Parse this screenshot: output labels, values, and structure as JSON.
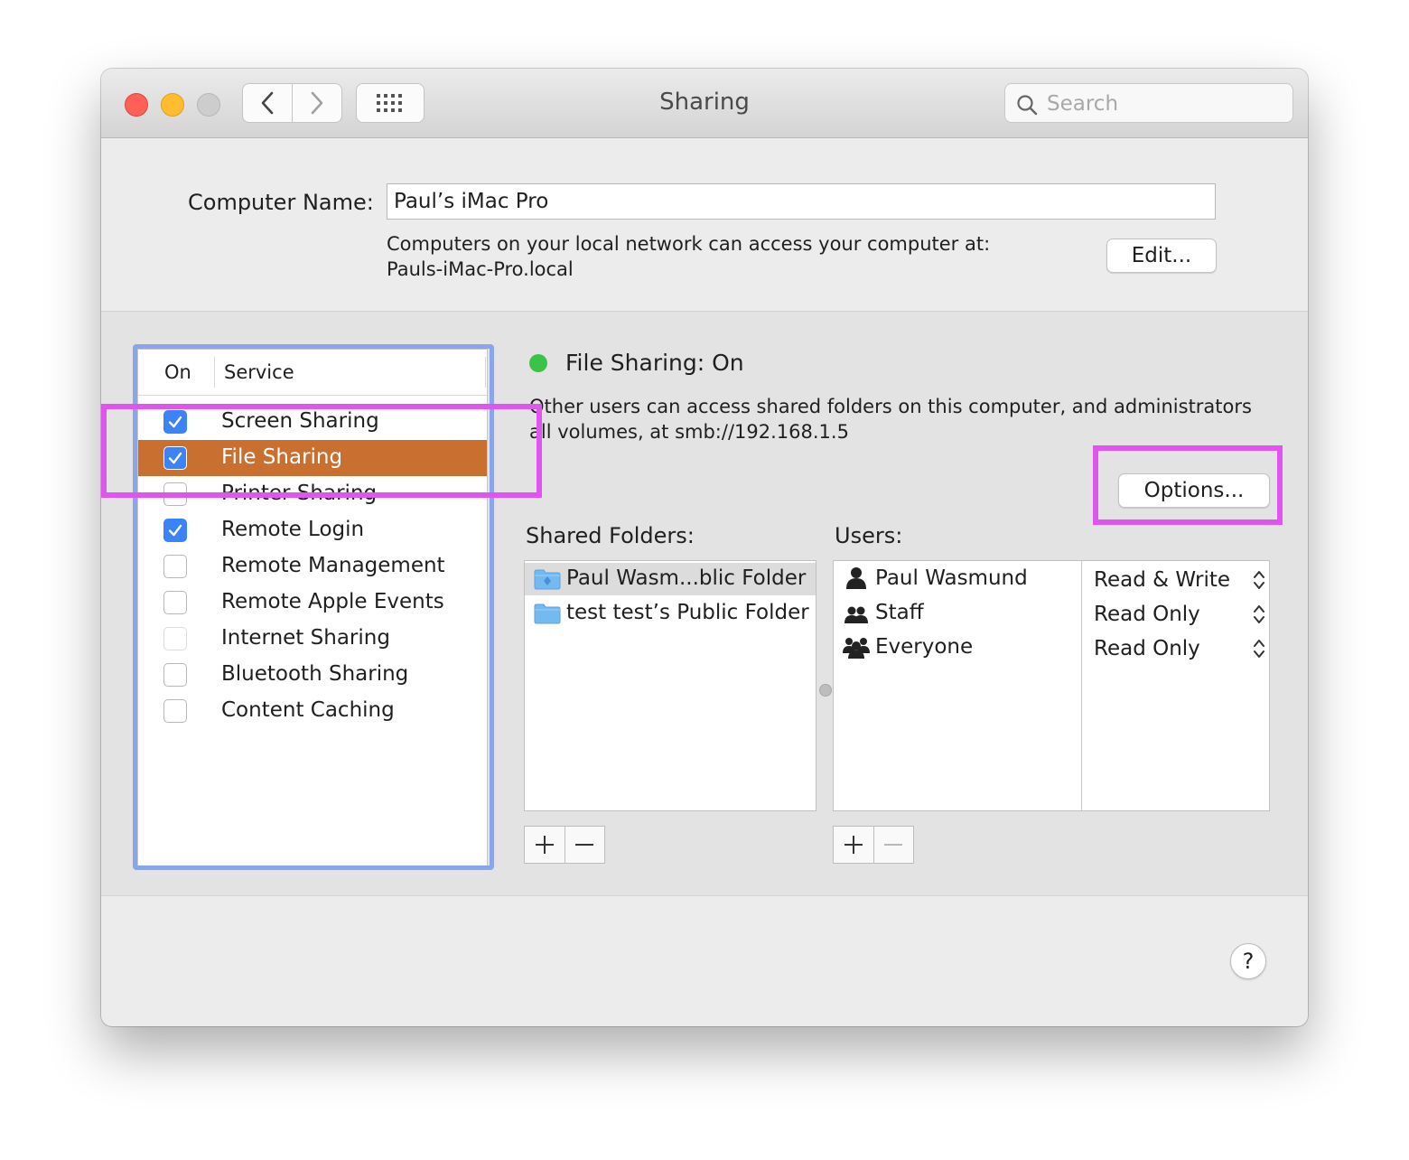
{
  "window": {
    "title": "Sharing",
    "search_placeholder": "Search"
  },
  "computer_name": {
    "label": "Computer Name:",
    "value": "Paul’s iMac Pro",
    "info_line1": "Computers on your local network can access your computer at:",
    "info_line2": "Pauls-iMac-Pro.local",
    "edit_label": "Edit..."
  },
  "services": {
    "header_on": "On",
    "header_service": "Service",
    "items": [
      {
        "label": "Screen Sharing",
        "checked": true
      },
      {
        "label": "File Sharing",
        "checked": true,
        "selected": true
      },
      {
        "label": "Printer Sharing",
        "checked": false
      },
      {
        "label": "Remote Login",
        "checked": true
      },
      {
        "label": "Remote Management",
        "checked": false
      },
      {
        "label": "Remote Apple Events",
        "checked": false
      },
      {
        "label": "Internet Sharing",
        "checked": false,
        "disabled": true
      },
      {
        "label": "Bluetooth Sharing",
        "checked": false
      },
      {
        "label": "Content Caching",
        "checked": false
      }
    ]
  },
  "detail": {
    "status": "File Sharing: On",
    "status_color": "#3cc24a",
    "desc_line1": "Other users can access shared folders on this computer, and administrators",
    "desc_line2": "all volumes, at smb://192.168.1.5",
    "options_label": "Options...",
    "shared_folders_label": "Shared Folders:",
    "users_label": "Users:",
    "folders": [
      {
        "name": "Paul Wasm...blic Folder",
        "icon": "public-folder-icon"
      },
      {
        "name": "test test’s Public Folder",
        "icon": "folder-icon"
      }
    ],
    "users": [
      {
        "name": "Paul Wasmund",
        "permission": "Read & Write",
        "icon": "user-icon"
      },
      {
        "name": "Staff",
        "permission": "Read Only",
        "icon": "group-icon"
      },
      {
        "name": "Everyone",
        "permission": "Read Only",
        "icon": "everyone-icon"
      }
    ]
  },
  "colors": {
    "selection": "#c96f2f",
    "checkbox_on": "#3b83f6",
    "highlight_pink": "#e055f0",
    "highlight_blue": "#8aa6e8"
  },
  "help_label": "?"
}
